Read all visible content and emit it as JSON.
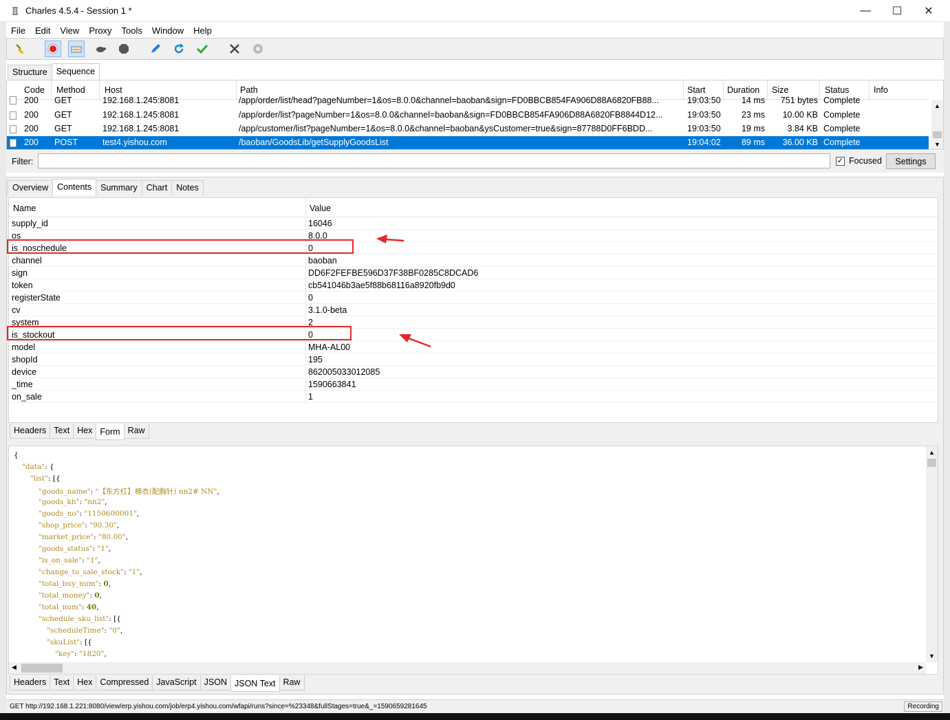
{
  "window": {
    "title": "Charles 4.5.4 - Session 1 *",
    "controls": {
      "minimize": "—",
      "maximize": "☐",
      "close": "✕"
    }
  },
  "menu": [
    "File",
    "Edit",
    "View",
    "Proxy",
    "Tools",
    "Window",
    "Help"
  ],
  "toolbar": {
    "icons": [
      "broom-icon",
      "record-icon",
      "throttle-icon",
      "turtle-icon",
      "hexagon-stop-icon",
      "pen-icon",
      "refresh-icon",
      "check-icon",
      "tools-icon",
      "gear-icon"
    ]
  },
  "view_tabs": [
    "Structure",
    "Sequence"
  ],
  "sequence": {
    "columns": [
      "Code",
      "Method",
      "Host",
      "Path",
      "Start",
      "Duration",
      "Size",
      "Status",
      "Info"
    ],
    "rows": [
      {
        "code": "200",
        "method": "GET",
        "host": "192.168.1.245:8081",
        "path": "/app/order/list/head?pageNumber=1&os=8.0.0&channel=baoban&sign=FD0BBCB854FA906D88A6820FB88...",
        "start": "19:03:50",
        "duration": "14 ms",
        "size": "751 bytes",
        "status": "Complete",
        "info": ""
      },
      {
        "code": "200",
        "method": "GET",
        "host": "192.168.1.245:8081",
        "path": "/app/order/list?pageNumber=1&os=8.0.0&channel=baoban&sign=FD0BBCB854FA906D88A6820FB8844D12...",
        "start": "19:03:50",
        "duration": "23 ms",
        "size": "10.00 KB",
        "status": "Complete",
        "info": ""
      },
      {
        "code": "200",
        "method": "GET",
        "host": "192.168.1.245:8081",
        "path": "/app/customer/list?pageNumber=1&os=8.0.0&channel=baoban&ysCustomer=true&sign=87788D0FF6BDD...",
        "start": "19:03:50",
        "duration": "19 ms",
        "size": "3.84 KB",
        "status": "Complete",
        "info": ""
      },
      {
        "code": "200",
        "method": "POST",
        "host": "test4.yishou.com",
        "path": "/baoban/GoodsLib/getSupplyGoodsList",
        "start": "19:04:02",
        "duration": "89 ms",
        "size": "36.00 KB",
        "status": "Complete",
        "info": ""
      }
    ]
  },
  "filter": {
    "label": "Filter:",
    "value": "",
    "focused_label": "Focused",
    "settings_label": "Settings"
  },
  "detail_tabs": [
    "Overview",
    "Contents",
    "Summary",
    "Chart",
    "Notes"
  ],
  "form": {
    "columns": [
      "Name",
      "Value"
    ],
    "rows": [
      {
        "name": "supply_id",
        "value": "16046"
      },
      {
        "name": "os",
        "value": "8.0.0"
      },
      {
        "name": "is_noschedule",
        "value": "0"
      },
      {
        "name": "channel",
        "value": "baoban"
      },
      {
        "name": "sign",
        "value": "DD6F2FEFBE596D37F38BF0285C8DCAD6"
      },
      {
        "name": "token",
        "value": "cb541046b3ae5f88b68116a8920fb9d0"
      },
      {
        "name": "registerState",
        "value": "0"
      },
      {
        "name": "cv",
        "value": "3.1.0-beta"
      },
      {
        "name": "system",
        "value": "2"
      },
      {
        "name": "is_stockout",
        "value": "0"
      },
      {
        "name": "model",
        "value": "MHA-AL00"
      },
      {
        "name": "shopId",
        "value": "195"
      },
      {
        "name": "device",
        "value": "862005033012085"
      },
      {
        "name": "_time",
        "value": "1590663841"
      },
      {
        "name": "on_sale",
        "value": "1"
      }
    ]
  },
  "request_tabs": [
    "Headers",
    "Text",
    "Hex",
    "Form",
    "Raw"
  ],
  "json_lines": [
    {
      "indent": 0,
      "text": "{"
    },
    {
      "indent": 1,
      "key": "\"data\"",
      "rest": ": {"
    },
    {
      "indent": 2,
      "key": "\"list\"",
      "rest": ": [{"
    },
    {
      "indent": 3,
      "key": "\"goods_name\"",
      "rest": ": ",
      "str": "\"【东方红】棉衣(配胸针)  nn2#  NN\"",
      "tail": ","
    },
    {
      "indent": 3,
      "key": "\"goods_kh\"",
      "rest": ": ",
      "str": "\"nn2\"",
      "tail": ","
    },
    {
      "indent": 3,
      "key": "\"goods_no\"",
      "rest": ": ",
      "str": "\"1150600001\"",
      "tail": ","
    },
    {
      "indent": 3,
      "key": "\"shop_price\"",
      "rest": ": ",
      "str": "\"90.30\"",
      "tail": ","
    },
    {
      "indent": 3,
      "key": "\"market_price\"",
      "rest": ": ",
      "str": "\"80.00\"",
      "tail": ","
    },
    {
      "indent": 3,
      "key": "\"goods_status\"",
      "rest": ": ",
      "str": "\"1\"",
      "tail": ","
    },
    {
      "indent": 3,
      "key": "\"is_on_sale\"",
      "rest": ": ",
      "str": "\"1\"",
      "tail": ","
    },
    {
      "indent": 3,
      "key": "\"change_to_sale_stock\"",
      "rest": ": ",
      "str": "\"1\"",
      "tail": ","
    },
    {
      "indent": 3,
      "key": "\"total_buy_num\"",
      "rest": ": ",
      "num": "0",
      "tail": ","
    },
    {
      "indent": 3,
      "key": "\"total_money\"",
      "rest": ": ",
      "num": "0",
      "tail": ","
    },
    {
      "indent": 3,
      "key": "\"total_num\"",
      "rest": ": ",
      "num": "40",
      "tail": ","
    },
    {
      "indent": 3,
      "key": "\"schedule_sku_list\"",
      "rest": ": [{"
    },
    {
      "indent": 4,
      "key": "\"scheduleTime\"",
      "rest": ": ",
      "str": "\"0\"",
      "tail": ","
    },
    {
      "indent": 4,
      "key": "\"skuList\"",
      "rest": ": [{"
    },
    {
      "indent": 5,
      "key": "\"key\"",
      "rest": ": ",
      "str": "\"1820\"",
      "tail": ","
    }
  ],
  "response_tabs": [
    "Headers",
    "Text",
    "Hex",
    "Compressed",
    "JavaScript",
    "JSON",
    "JSON Text",
    "Raw"
  ],
  "status_bar": {
    "text": "GET http://192.168.1.221:8080/view/erp.yishou.com/job/erp4.yishou.com/wfapi/runs?since=%23348&fullStages=true&_=1590659281645",
    "recording": "Recording"
  }
}
